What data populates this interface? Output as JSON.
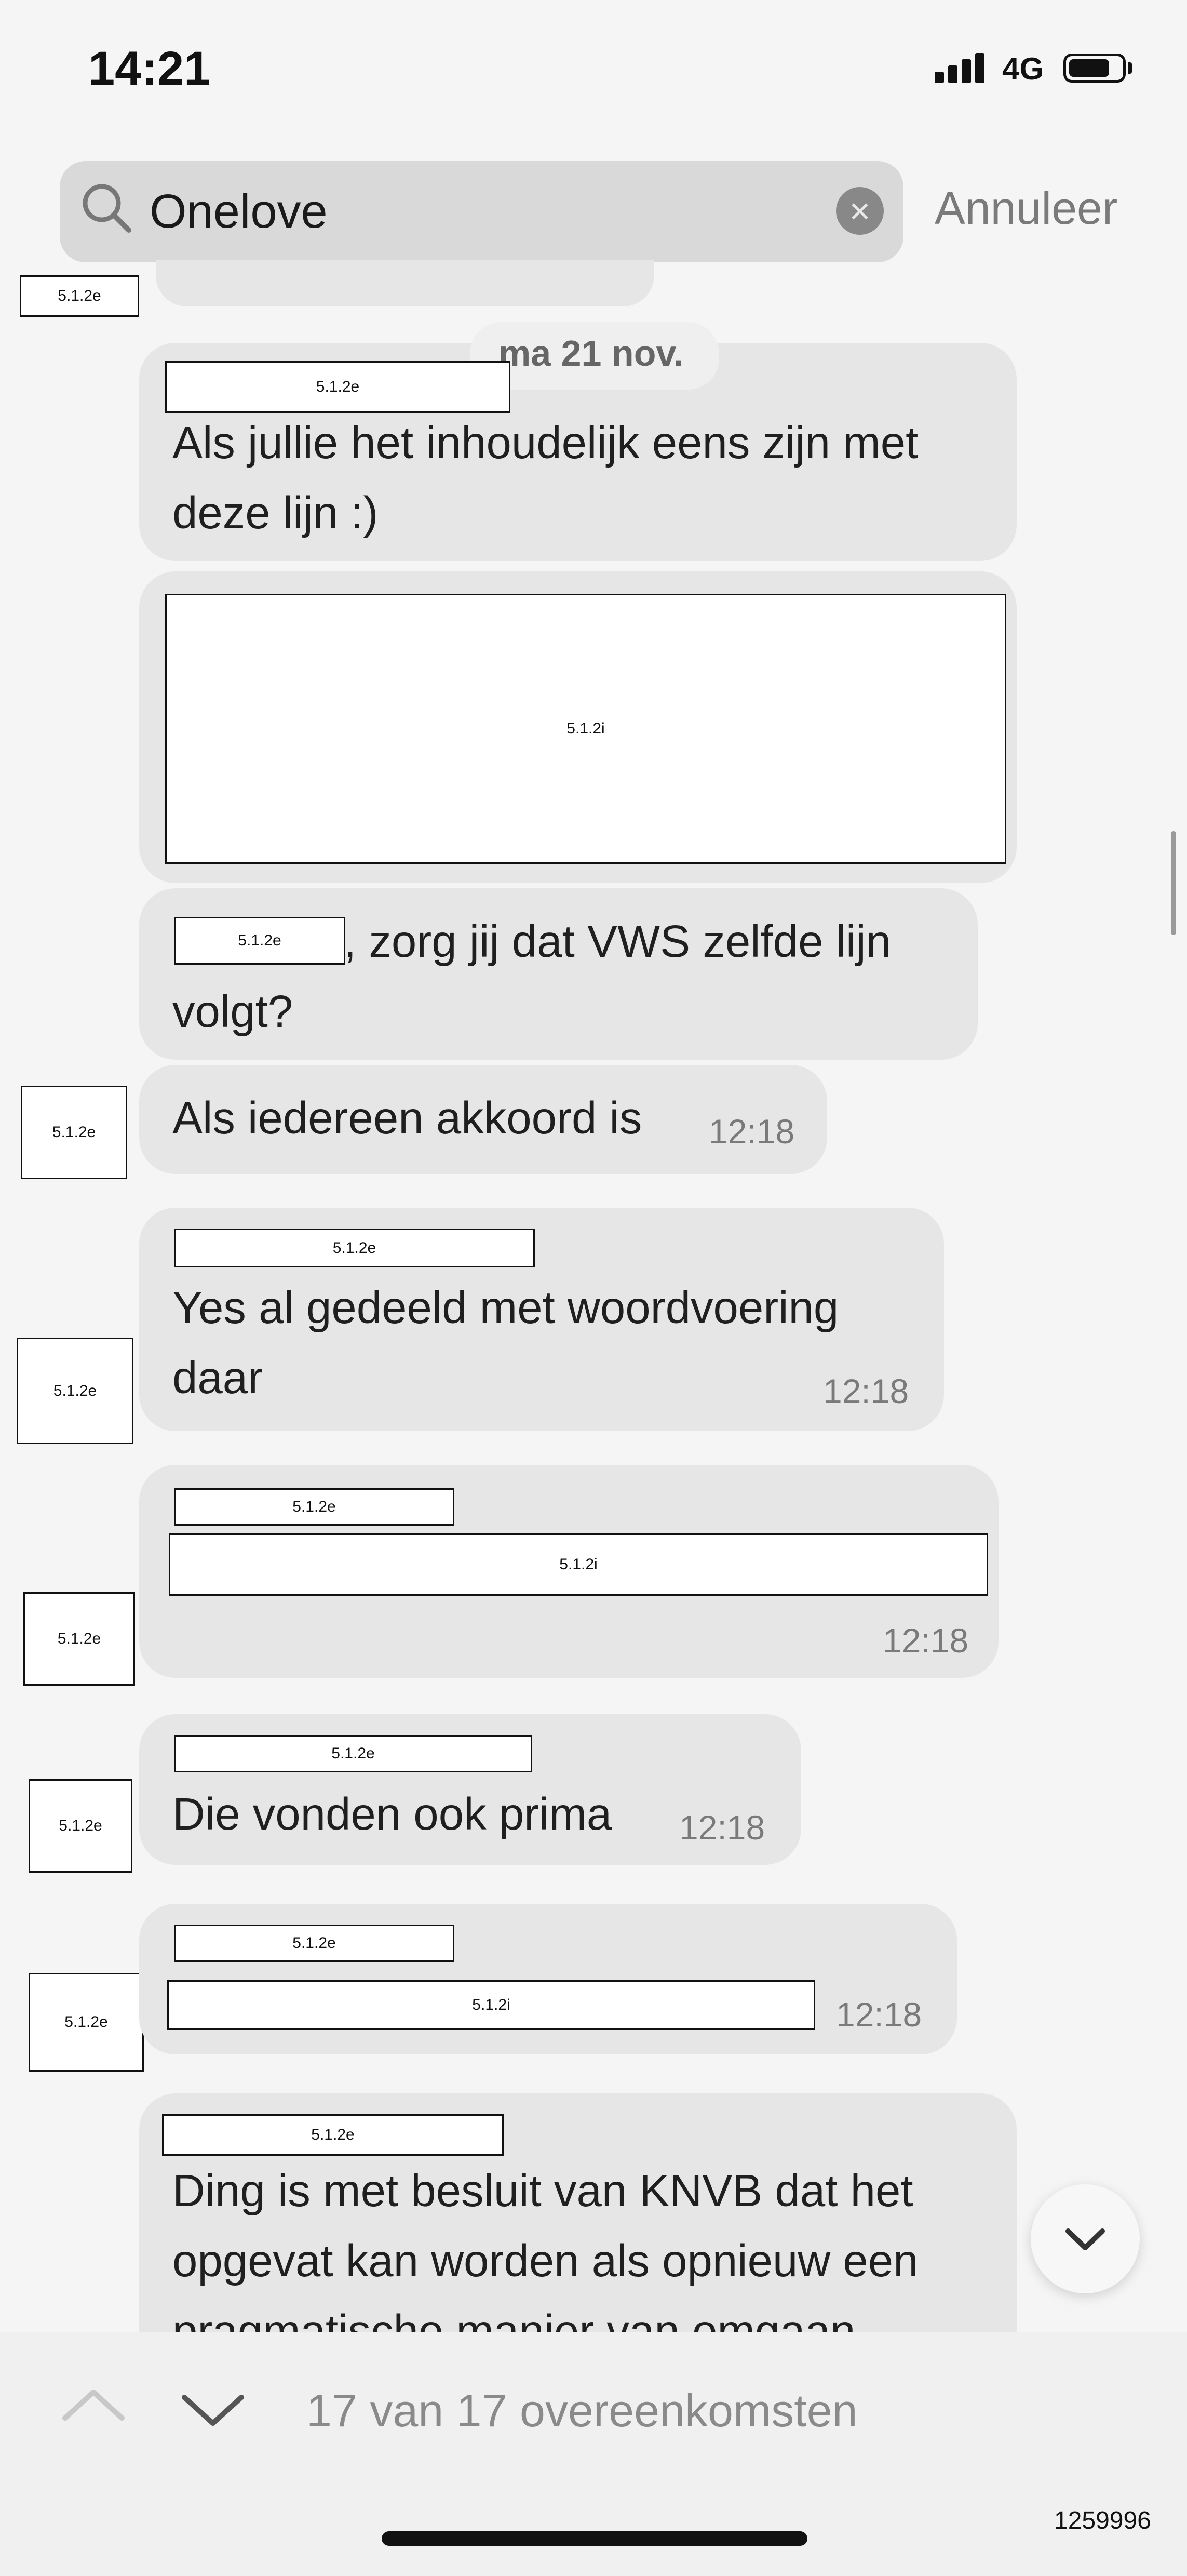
{
  "status_bar": {
    "time": "14:21",
    "network": "4G"
  },
  "search": {
    "query": "Onelove",
    "cancel_label": "Annuleer"
  },
  "date_separator": "ma 21 nov.",
  "messages": [
    {
      "sender": "5.1.2e",
      "lines": [
        "Als jullie het inhoudelijk eens zijn met",
        "deze lijn :)"
      ]
    },
    {
      "attachment": "5.1.2i"
    },
    {
      "mention": "5.1.2e",
      "lines": [
        ", zorg jij dat VWS zelfde lijn",
        "volgt?"
      ]
    },
    {
      "avatar": "5.1.2e",
      "text": "Als iedereen akkoord is",
      "time": "12:18"
    },
    {
      "avatar": "5.1.2e",
      "sender": "5.1.2e",
      "lines": [
        "Yes al gedeeld met woordvoering",
        "daar"
      ],
      "time": "12:18"
    },
    {
      "avatar": "5.1.2e",
      "sender": "5.1.2e",
      "attachment": "5.1.2i",
      "time": "12:18"
    },
    {
      "avatar": "5.1.2e",
      "sender": "5.1.2e",
      "text": "Die vonden ook prima",
      "time": "12:18"
    },
    {
      "avatar": "5.1.2e",
      "sender": "5.1.2e",
      "attachment": "5.1.2i",
      "time": "12:18"
    },
    {
      "sender": "5.1.2e",
      "lines": [
        "Ding is met besluit van KNVB dat het",
        "opgevat kan worden als opnieuw een",
        "pragmatische manier van omgaan"
      ]
    }
  ],
  "top_avatar": "5.1.2e",
  "footer": {
    "match_count": "17 van 17 overeenkomsten",
    "doc_id": "1259996"
  }
}
